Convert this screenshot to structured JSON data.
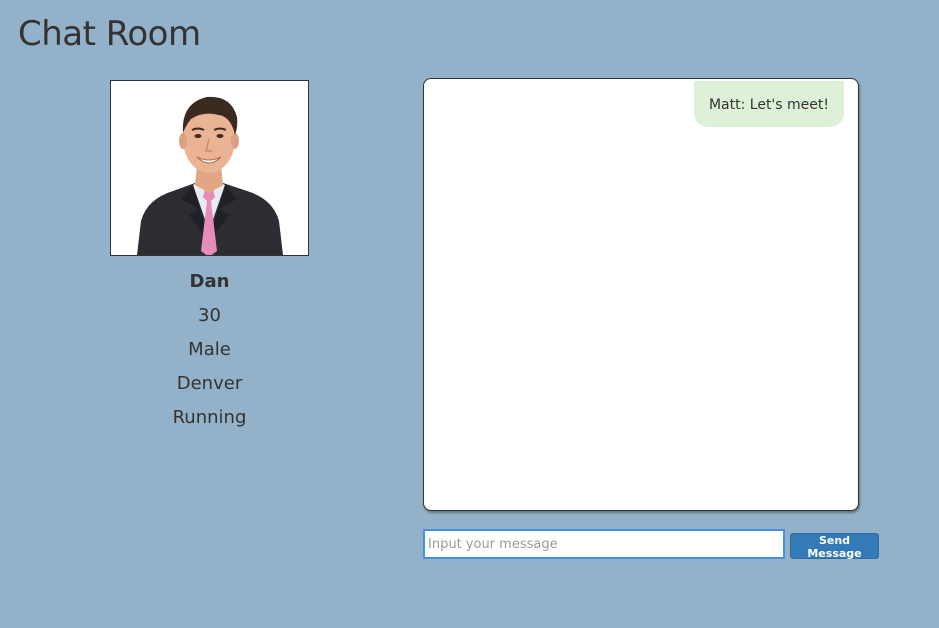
{
  "page": {
    "title": "Chat Room"
  },
  "profile": {
    "name": "Dan",
    "age": "30",
    "gender": "Male",
    "location": "Denver",
    "hobby": "Running"
  },
  "chat": {
    "messages": [
      {
        "text": "Matt: Let's meet!"
      }
    ]
  },
  "composer": {
    "placeholder": "Input your message",
    "value": "",
    "send_label": "Send Message"
  },
  "colors": {
    "background": "#93b1c8",
    "message_bubble": "#dff0d8",
    "send_button": "#337ab7",
    "input_focus_border": "#4a90e2"
  }
}
